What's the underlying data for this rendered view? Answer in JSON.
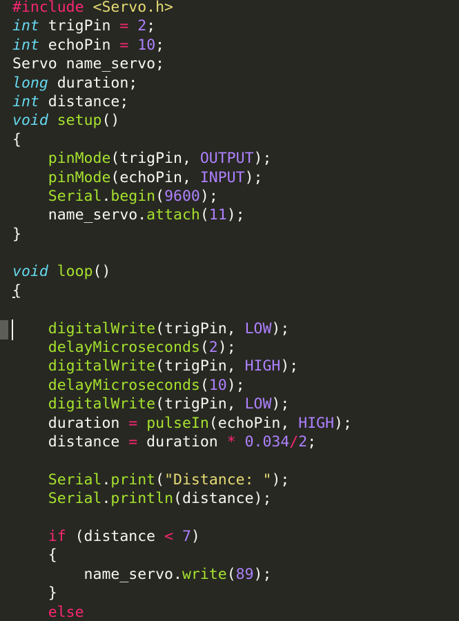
{
  "editor": {
    "lines": [
      [
        {
          "t": "#include ",
          "c": "pp"
        },
        {
          "t": "<Servo.h>",
          "c": "str"
        }
      ],
      [
        {
          "t": "int",
          "c": "kw"
        },
        {
          "t": " trigPin ",
          "c": "plain"
        },
        {
          "t": "=",
          "c": "op"
        },
        {
          "t": " ",
          "c": "plain"
        },
        {
          "t": "2",
          "c": "num"
        },
        {
          "t": ";",
          "c": "plain"
        }
      ],
      [
        {
          "t": "int",
          "c": "kw"
        },
        {
          "t": " echoPin ",
          "c": "plain"
        },
        {
          "t": "=",
          "c": "op"
        },
        {
          "t": " ",
          "c": "plain"
        },
        {
          "t": "10",
          "c": "num"
        },
        {
          "t": ";",
          "c": "plain"
        }
      ],
      [
        {
          "t": "Servo name_servo;",
          "c": "plain"
        }
      ],
      [
        {
          "t": "long",
          "c": "kw"
        },
        {
          "t": " duration;",
          "c": "plain"
        }
      ],
      [
        {
          "t": "int",
          "c": "kw"
        },
        {
          "t": " distance;",
          "c": "plain"
        }
      ],
      [
        {
          "t": "void",
          "c": "kw"
        },
        {
          "t": " ",
          "c": "plain"
        },
        {
          "t": "setup",
          "c": "fn"
        },
        {
          "t": "()",
          "c": "plain"
        }
      ],
      [
        {
          "t": "{",
          "c": "plain"
        }
      ],
      [
        {
          "t": "    ",
          "c": "plain"
        },
        {
          "t": "pinMode",
          "c": "fn"
        },
        {
          "t": "(trigPin, ",
          "c": "plain"
        },
        {
          "t": "OUTPUT",
          "c": "const"
        },
        {
          "t": ");",
          "c": "plain"
        }
      ],
      [
        {
          "t": "    ",
          "c": "plain"
        },
        {
          "t": "pinMode",
          "c": "fn"
        },
        {
          "t": "(echoPin, ",
          "c": "plain"
        },
        {
          "t": "INPUT",
          "c": "const"
        },
        {
          "t": ");",
          "c": "plain"
        }
      ],
      [
        {
          "t": "    ",
          "c": "plain"
        },
        {
          "t": "Serial",
          "c": "cls"
        },
        {
          "t": ".",
          "c": "plain"
        },
        {
          "t": "begin",
          "c": "fn"
        },
        {
          "t": "(",
          "c": "plain"
        },
        {
          "t": "9600",
          "c": "num"
        },
        {
          "t": ");",
          "c": "plain"
        }
      ],
      [
        {
          "t": "    name_servo.",
          "c": "plain"
        },
        {
          "t": "attach",
          "c": "fn"
        },
        {
          "t": "(",
          "c": "plain"
        },
        {
          "t": "11",
          "c": "num"
        },
        {
          "t": ");",
          "c": "plain"
        }
      ],
      [
        {
          "t": "}",
          "c": "plain"
        }
      ],
      [
        {
          "t": "",
          "c": "plain"
        }
      ],
      [
        {
          "t": "void",
          "c": "kw"
        },
        {
          "t": " ",
          "c": "plain"
        },
        {
          "t": "loop",
          "c": "fn"
        },
        {
          "t": "()",
          "c": "plain"
        }
      ],
      [
        {
          "t": "{",
          "c": "plain underline"
        }
      ],
      [
        {
          "t": "",
          "c": "plain"
        }
      ],
      [
        {
          "t": "    ",
          "c": "plain"
        },
        {
          "t": "digitalWrite",
          "c": "fn"
        },
        {
          "t": "(trigPin, ",
          "c": "plain"
        },
        {
          "t": "LOW",
          "c": "const"
        },
        {
          "t": ");",
          "c": "plain"
        }
      ],
      [
        {
          "t": "    ",
          "c": "plain"
        },
        {
          "t": "delayMicroseconds",
          "c": "fn"
        },
        {
          "t": "(",
          "c": "plain"
        },
        {
          "t": "2",
          "c": "num"
        },
        {
          "t": ");",
          "c": "plain"
        }
      ],
      [
        {
          "t": "    ",
          "c": "plain"
        },
        {
          "t": "digitalWrite",
          "c": "fn"
        },
        {
          "t": "(trigPin, ",
          "c": "plain"
        },
        {
          "t": "HIGH",
          "c": "const"
        },
        {
          "t": ");",
          "c": "plain"
        }
      ],
      [
        {
          "t": "    ",
          "c": "plain"
        },
        {
          "t": "delayMicroseconds",
          "c": "fn"
        },
        {
          "t": "(",
          "c": "plain"
        },
        {
          "t": "10",
          "c": "num"
        },
        {
          "t": ");",
          "c": "plain"
        }
      ],
      [
        {
          "t": "    ",
          "c": "plain"
        },
        {
          "t": "digitalWrite",
          "c": "fn"
        },
        {
          "t": "(trigPin, ",
          "c": "plain"
        },
        {
          "t": "LOW",
          "c": "const"
        },
        {
          "t": ");",
          "c": "plain"
        }
      ],
      [
        {
          "t": "    duration ",
          "c": "plain"
        },
        {
          "t": "=",
          "c": "op"
        },
        {
          "t": " ",
          "c": "plain"
        },
        {
          "t": "pulseIn",
          "c": "fn"
        },
        {
          "t": "(echoPin, ",
          "c": "plain"
        },
        {
          "t": "HIGH",
          "c": "const"
        },
        {
          "t": ");",
          "c": "plain"
        }
      ],
      [
        {
          "t": "    distance ",
          "c": "plain"
        },
        {
          "t": "=",
          "c": "op"
        },
        {
          "t": " duration ",
          "c": "plain"
        },
        {
          "t": "*",
          "c": "op"
        },
        {
          "t": " ",
          "c": "plain"
        },
        {
          "t": "0.034",
          "c": "num"
        },
        {
          "t": "/",
          "c": "op"
        },
        {
          "t": "2",
          "c": "num"
        },
        {
          "t": ";",
          "c": "plain"
        }
      ],
      [
        {
          "t": "",
          "c": "plain"
        }
      ],
      [
        {
          "t": "    ",
          "c": "plain"
        },
        {
          "t": "Serial",
          "c": "cls"
        },
        {
          "t": ".",
          "c": "plain"
        },
        {
          "t": "print",
          "c": "fn"
        },
        {
          "t": "(",
          "c": "plain"
        },
        {
          "t": "\"Distance: \"",
          "c": "str"
        },
        {
          "t": ");",
          "c": "plain"
        }
      ],
      [
        {
          "t": "    ",
          "c": "plain"
        },
        {
          "t": "Serial",
          "c": "cls"
        },
        {
          "t": ".",
          "c": "plain"
        },
        {
          "t": "println",
          "c": "fn"
        },
        {
          "t": "(distance);",
          "c": "plain"
        }
      ],
      [
        {
          "t": "",
          "c": "plain"
        }
      ],
      [
        {
          "t": "    ",
          "c": "plain"
        },
        {
          "t": "if",
          "c": "ctrl"
        },
        {
          "t": " (distance ",
          "c": "plain"
        },
        {
          "t": "<",
          "c": "op"
        },
        {
          "t": " ",
          "c": "plain"
        },
        {
          "t": "7",
          "c": "num"
        },
        {
          "t": ")",
          "c": "plain"
        }
      ],
      [
        {
          "t": "    {",
          "c": "plain"
        }
      ],
      [
        {
          "t": "        name_servo.",
          "c": "plain"
        },
        {
          "t": "write",
          "c": "fn"
        },
        {
          "t": "(",
          "c": "plain"
        },
        {
          "t": "89",
          "c": "num"
        },
        {
          "t": ");",
          "c": "plain"
        }
      ],
      [
        {
          "t": "    }",
          "c": "plain"
        }
      ],
      [
        {
          "t": "    ",
          "c": "plain"
        },
        {
          "t": "else",
          "c": "ctrl"
        }
      ]
    ]
  },
  "colors": {
    "background": "#272822",
    "foreground": "#f8f8f2",
    "keyword": "#66d9ef",
    "function": "#a6e22e",
    "number": "#ae81ff",
    "string": "#e6db74",
    "operator": "#f92672"
  }
}
